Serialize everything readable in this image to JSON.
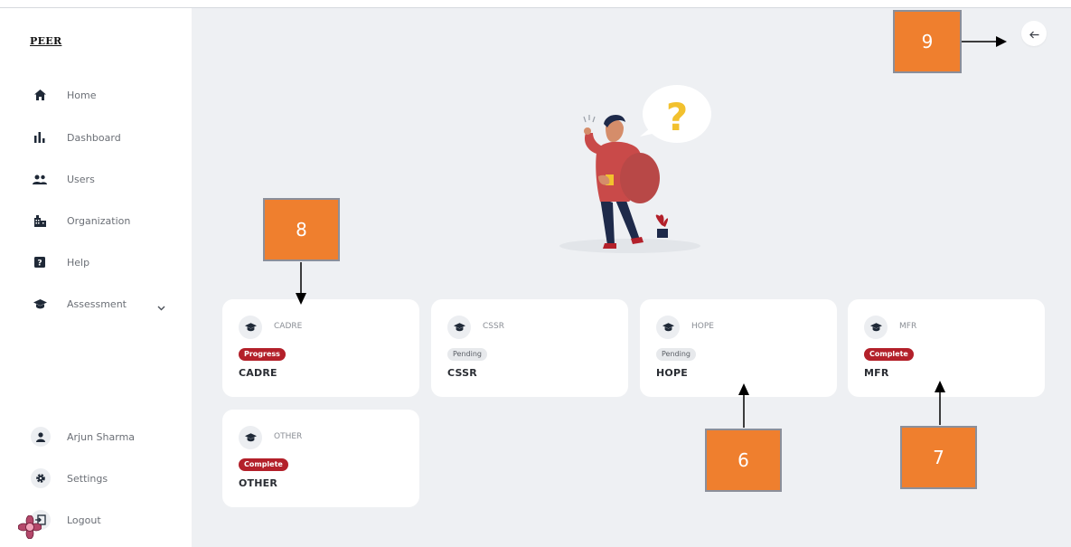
{
  "brand": "PEER",
  "sidebar": {
    "items": [
      {
        "label": "Home",
        "icon": "home-icon"
      },
      {
        "label": "Dashboard",
        "icon": "bar-chart-icon"
      },
      {
        "label": "Users",
        "icon": "users-icon"
      },
      {
        "label": "Organization",
        "icon": "building-icon"
      },
      {
        "label": "Help",
        "icon": "help-icon"
      },
      {
        "label": "Assessment",
        "icon": "graduation-cap-icon"
      }
    ],
    "user_name": "Arjun Sharma",
    "settings_label": "Settings",
    "logout_label": "Logout"
  },
  "cards": [
    {
      "tag": "CADRE",
      "status": "Progress",
      "title": "CADRE"
    },
    {
      "tag": "CSSR",
      "status": "Pending",
      "title": "CSSR"
    },
    {
      "tag": "HOPE",
      "status": "Pending",
      "title": "HOPE"
    },
    {
      "tag": "MFR",
      "status": "Complete",
      "title": "MFR"
    },
    {
      "tag": "OTHER",
      "status": "Complete",
      "title": "OTHER"
    }
  ],
  "annotations": [
    "9",
    "8",
    "6",
    "7"
  ],
  "colors": {
    "accent_red": "#b3202a",
    "annotation_orange": "#ef7f2e",
    "main_bg": "#eef0f3"
  }
}
